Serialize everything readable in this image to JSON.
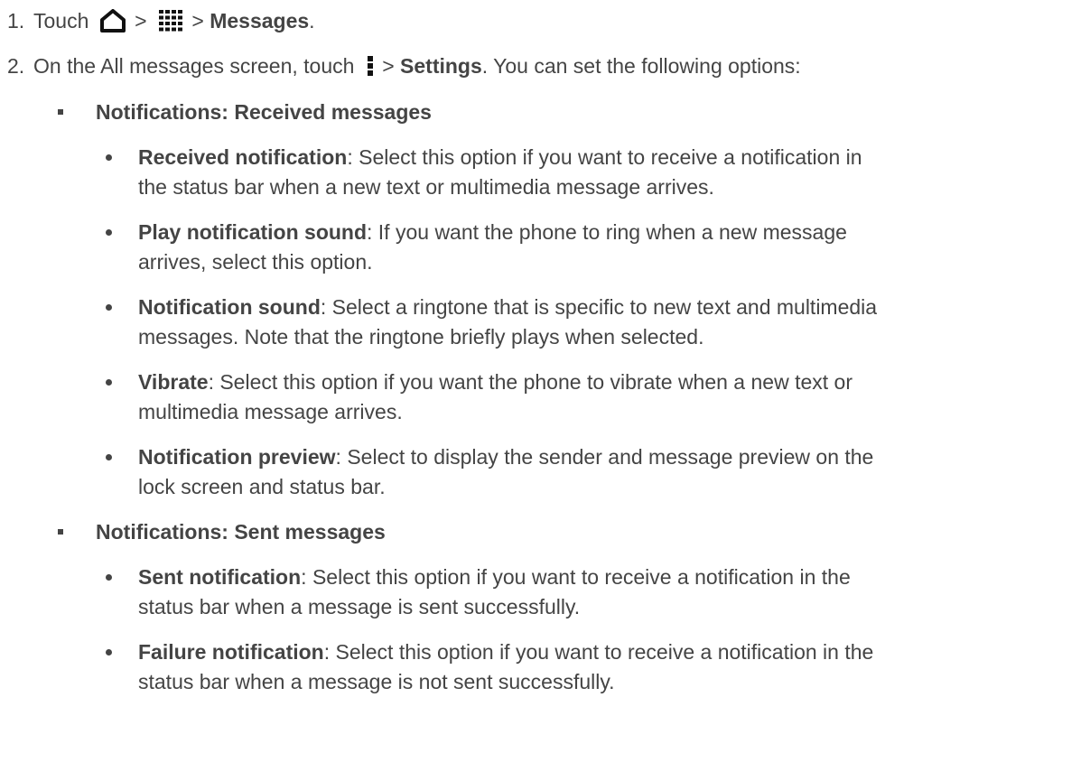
{
  "steps": [
    {
      "number": "1.",
      "prefix": "Touch",
      "icons": [
        "home-icon",
        "apps-grid-icon"
      ],
      "sep": ">",
      "bold": "Messages",
      "suffix": "."
    },
    {
      "number": "2.",
      "prefix": "On the All messages screen, touch",
      "icons": [
        "menu-dots-icon"
      ],
      "sep": ">",
      "bold": "Settings",
      "suffix": ". You can set the following options:"
    }
  ],
  "groups": [
    {
      "heading": "Notifications: Received messages",
      "items": [
        {
          "term": "Received notification",
          "lines": [
            ": Select this option if you want to receive a notification in",
            "the status bar when a new text or multimedia message arrives."
          ]
        },
        {
          "term": "Play notification sound",
          "lines": [
            ": If you want the phone to ring when a new message",
            "arrives, select this option."
          ]
        },
        {
          "term": "Notification sound",
          "lines": [
            ": Select a ringtone that is specific to new text and multimedia",
            "messages. Note that the ringtone briefly plays when selected."
          ]
        },
        {
          "term": "Vibrate",
          "lines": [
            ": Select this option if you want the phone to vibrate when a new text or",
            "multimedia message arrives."
          ]
        },
        {
          "term": "Notification preview",
          "lines": [
            ": Select to display the sender and message preview on the",
            "lock screen and status bar."
          ]
        }
      ]
    },
    {
      "heading": "Notifications: Sent messages",
      "items": [
        {
          "term": "Sent notification",
          "lines": [
            ": Select this option if you want to receive a notification in the",
            "status bar when a message is sent successfully."
          ]
        },
        {
          "term": "Failure notification",
          "lines": [
            ": Select this option if you want to receive a notification in the",
            "status bar when a message is not sent successfully."
          ]
        }
      ]
    }
  ]
}
